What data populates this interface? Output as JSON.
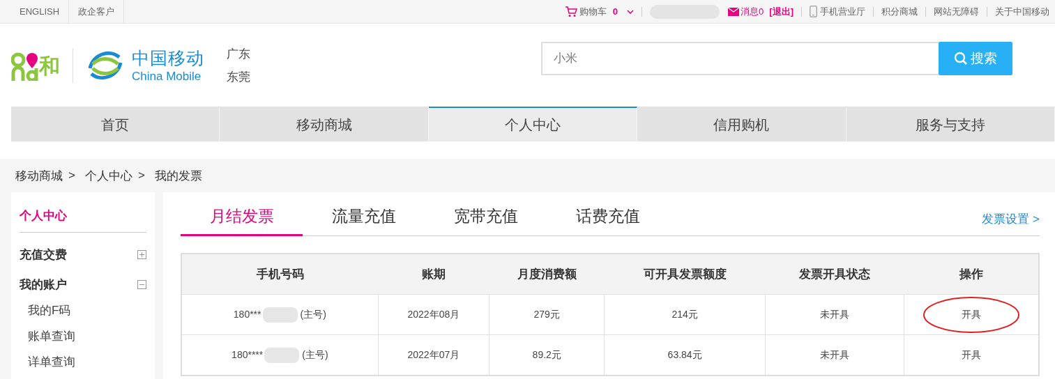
{
  "top_bar": {
    "left_links": [
      "ENGLISH",
      "政企客户"
    ],
    "cart": {
      "label": "购物车",
      "count": "0"
    },
    "messages": {
      "label": "消息0",
      "logout": "[退出]"
    },
    "right_links": [
      {
        "kind": "phone",
        "label": "手机营业厅"
      },
      {
        "kind": "plain",
        "label": "积分商城"
      },
      {
        "kind": "plain",
        "label": "网站无障碍"
      },
      {
        "kind": "plain",
        "label": "关于中国移动"
      }
    ]
  },
  "header": {
    "brand_cn": "中国移动",
    "brand_en": "China Mobile",
    "and_logo": "和",
    "region": [
      "广东",
      "东莞"
    ],
    "search": {
      "value": "小米",
      "button": "搜索"
    }
  },
  "nav": [
    {
      "label": "首页",
      "selected": false
    },
    {
      "label": "移动商城",
      "selected": false
    },
    {
      "label": "个人中心",
      "selected": true
    },
    {
      "label": "信用购机",
      "selected": false
    },
    {
      "label": "服务与支持",
      "selected": false
    }
  ],
  "breadcrumb": {
    "items": [
      "移动商城",
      "个人中心",
      "我的发票"
    ],
    "separator": ">"
  },
  "sidebar": {
    "title": "个人中心",
    "groups": [
      {
        "label": "充值交费",
        "expanded": false
      },
      {
        "label": "我的账户",
        "expanded": true,
        "children": [
          "我的F码",
          "账单查询",
          "详单查询"
        ]
      }
    ]
  },
  "tabs": [
    {
      "label": "月结发票",
      "selected": true
    },
    {
      "label": "流量充值",
      "selected": false
    },
    {
      "label": "宽带充值",
      "selected": false
    },
    {
      "label": "话费充值",
      "selected": false
    }
  ],
  "settings_link": "发票设置 >",
  "table": {
    "columns": [
      "手机号码",
      "账期",
      "月度消费额",
      "可开具发票额度",
      "发票开具状态",
      "操作"
    ],
    "rows": [
      {
        "phone": "180***",
        "tag": "(主号)",
        "period": "2022年08月",
        "spend": "279元",
        "quota": "214元",
        "status": "未开具",
        "action": "开具",
        "circled": true
      },
      {
        "phone": "180****",
        "tag": "(主号)",
        "period": "2022年07月",
        "spend": "89.2元",
        "quota": "63.84元",
        "status": "未开具",
        "action": "开具",
        "circled": false
      }
    ]
  }
}
